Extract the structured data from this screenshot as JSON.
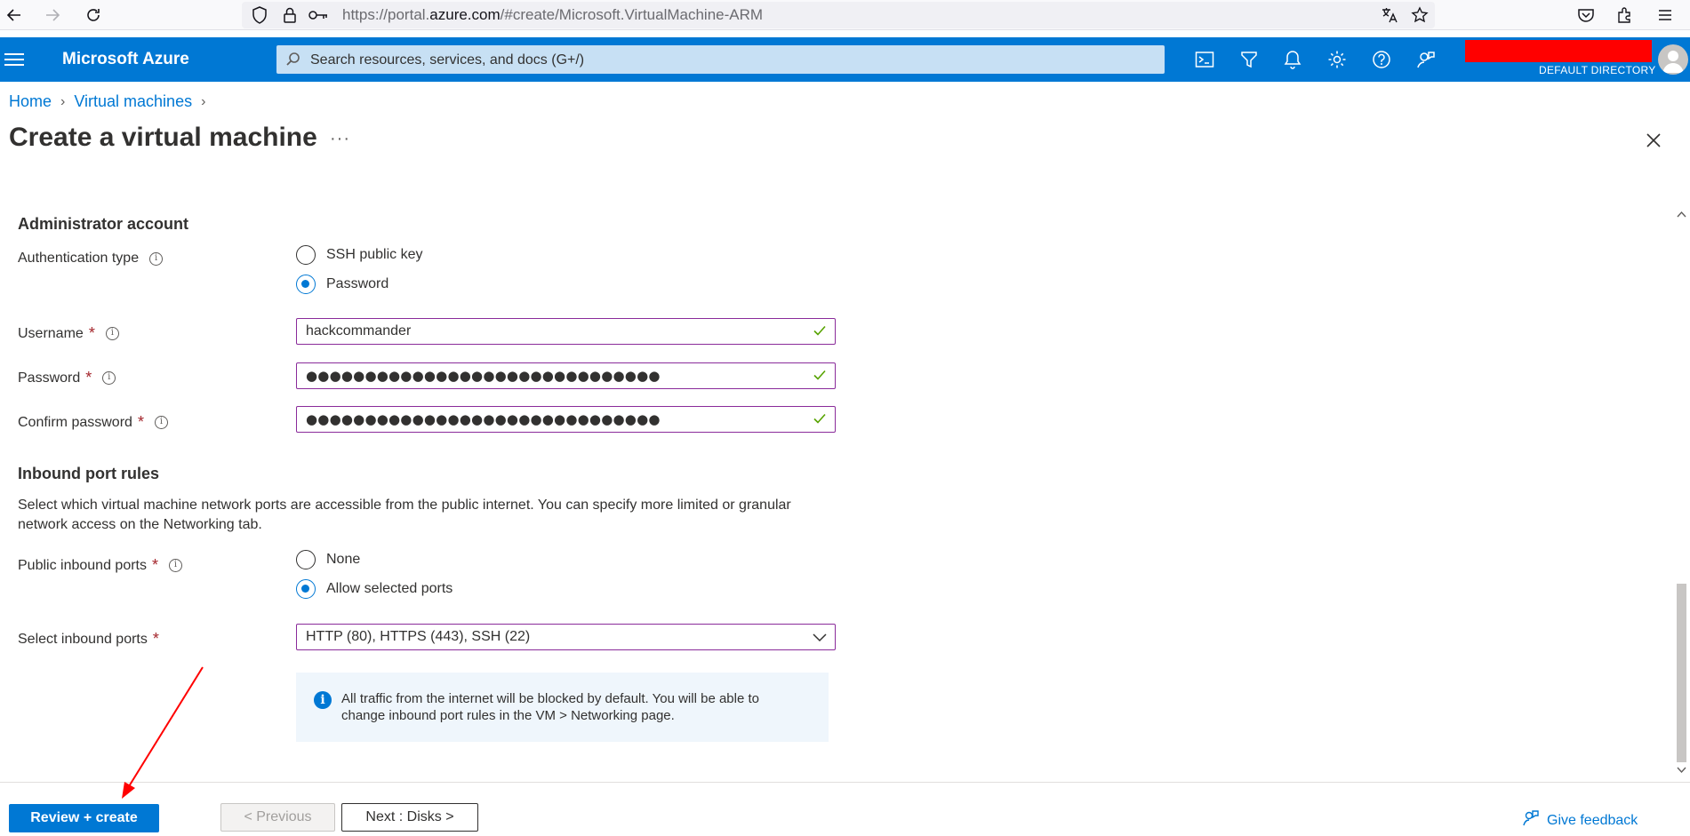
{
  "browser": {
    "url_prefix": "https://portal.",
    "url_domain": "azure.com",
    "url_suffix": "/#create/Microsoft.VirtualMachine-ARM"
  },
  "header": {
    "brand": "Microsoft Azure",
    "search_placeholder": "Search resources, services, and docs (G+/)",
    "directory": "DEFAULT DIRECTORY"
  },
  "breadcrumb": [
    "Home",
    "Virtual machines"
  ],
  "page": {
    "title": "Create a virtual machine",
    "more": "···"
  },
  "admin": {
    "section_title": "Administrator account",
    "auth_label": "Authentication type",
    "auth_options": [
      "SSH public key",
      "Password"
    ],
    "auth_selected": "Password",
    "username_label": "Username",
    "username_value": "hackcommander",
    "password_label": "Password",
    "password_value": "●●●●●●●●●●●●●●●●●●●●●●●●●●●●●●",
    "confirm_label": "Confirm password",
    "confirm_value": "●●●●●●●●●●●●●●●●●●●●●●●●●●●●●●",
    "required_mark": "*"
  },
  "inbound": {
    "section_title": "Inbound port rules",
    "description": "Select which virtual machine network ports are accessible from the public internet. You can specify more limited or granular network access on the Networking tab.",
    "public_label": "Public inbound ports",
    "public_options": [
      "None",
      "Allow selected ports"
    ],
    "public_selected": "Allow selected ports",
    "select_label": "Select inbound ports",
    "select_value": "HTTP (80), HTTPS (443), SSH (22)",
    "info_text": "All traffic from the internet will be blocked by default. You will be able to change inbound port rules in the VM > Networking page."
  },
  "footer": {
    "review_label": "Review + create",
    "previous_label": "< Previous",
    "next_label": "Next : Disks >",
    "feedback_label": "Give feedback"
  },
  "colors": {
    "azure_blue": "#0078d4",
    "valid_border": "#8a2b9a",
    "check_green": "#57a300",
    "annotation_red": "#ff0000"
  }
}
